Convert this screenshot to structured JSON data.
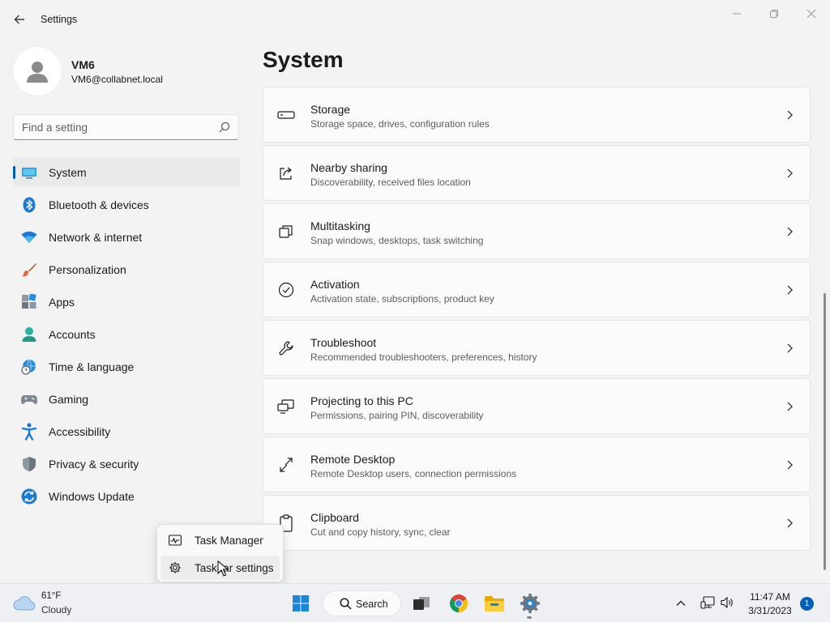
{
  "window": {
    "title": "Settings"
  },
  "profile": {
    "name": "VM6",
    "email": "VM6@collabnet.local"
  },
  "search": {
    "placeholder": "Find a setting"
  },
  "sidebar": {
    "items": [
      {
        "label": "System",
        "icon": "monitor-icon",
        "active": true
      },
      {
        "label": "Bluetooth & devices",
        "icon": "bluetooth-icon"
      },
      {
        "label": "Network & internet",
        "icon": "wifi-icon"
      },
      {
        "label": "Personalization",
        "icon": "brush-icon"
      },
      {
        "label": "Apps",
        "icon": "apps-icon"
      },
      {
        "label": "Accounts",
        "icon": "person-icon"
      },
      {
        "label": "Time & language",
        "icon": "globe-clock-icon"
      },
      {
        "label": "Gaming",
        "icon": "gamepad-icon"
      },
      {
        "label": "Accessibility",
        "icon": "accessibility-icon"
      },
      {
        "label": "Privacy & security",
        "icon": "shield-icon"
      },
      {
        "label": "Windows Update",
        "icon": "refresh-icon"
      }
    ]
  },
  "main": {
    "title": "System",
    "cards": [
      {
        "title": "Storage",
        "subtitle": "Storage space, drives, configuration rules",
        "icon": "storage-icon"
      },
      {
        "title": "Nearby sharing",
        "subtitle": "Discoverability, received files location",
        "icon": "share-icon"
      },
      {
        "title": "Multitasking",
        "subtitle": "Snap windows, desktops, task switching",
        "icon": "multitasking-icon"
      },
      {
        "title": "Activation",
        "subtitle": "Activation state, subscriptions, product key",
        "icon": "check-circle-icon"
      },
      {
        "title": "Troubleshoot",
        "subtitle": "Recommended troubleshooters, preferences, history",
        "icon": "wrench-icon"
      },
      {
        "title": "Projecting to this PC",
        "subtitle": "Permissions, pairing PIN, discoverability",
        "icon": "projecting-icon"
      },
      {
        "title": "Remote Desktop",
        "subtitle": "Remote Desktop users, connection permissions",
        "icon": "remote-desktop-icon"
      },
      {
        "title": "Clipboard",
        "subtitle": "Cut and copy history, sync, clear",
        "icon": "clipboard-icon"
      }
    ]
  },
  "context_menu": {
    "items": [
      {
        "label": "Task Manager",
        "icon": "task-manager-icon"
      },
      {
        "label": "Taskbar settings",
        "icon": "gear-icon",
        "hovered": true
      }
    ]
  },
  "taskbar": {
    "weather": {
      "temp": "61°F",
      "condition": "Cloudy"
    },
    "search_label": "Search",
    "clock": {
      "time": "11:47 AM",
      "date": "3/31/2023"
    },
    "notification_count": "1"
  },
  "colors": {
    "accent": "#005fb8",
    "background": "#f3f3f3",
    "card": "#fbfbfb"
  }
}
